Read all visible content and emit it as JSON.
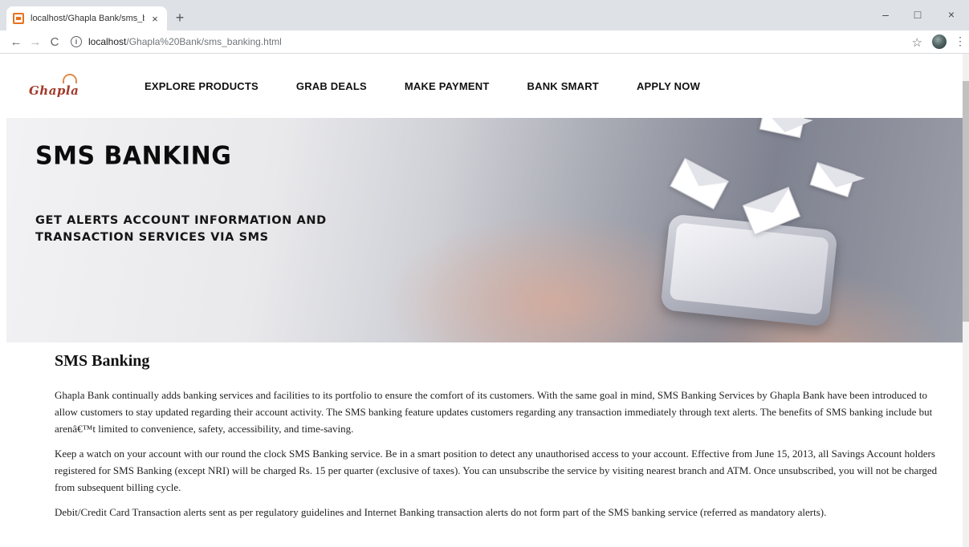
{
  "browser": {
    "tab_title": "localhost/Ghapla Bank/sms_bank",
    "tab_close": "×",
    "new_tab": "+",
    "url_host": "localhost",
    "url_path": "/Ghapla%20Bank/sms_banking.html",
    "window_controls": {
      "minimize": "–",
      "maximize": "□",
      "close": "×"
    },
    "nav": {
      "back": "←",
      "forward": "→",
      "reload": "C"
    },
    "star": "☆",
    "menu": "⋮",
    "favicon_color": "#e8711c"
  },
  "site": {
    "logo_text": "Ghapla",
    "nav_items": [
      "EXPLORE PRODUCTS",
      "GRAB DEALS",
      "MAKE PAYMENT",
      "BANK SMART",
      "APPLY NOW"
    ]
  },
  "hero": {
    "title": "SMS BANKING",
    "subtitle": "GET ALERTS ACCOUNT INFORMATION AND TRANSACTION SERVICES VIA SMS"
  },
  "content": {
    "heading": "SMS Banking",
    "paragraphs": [
      "Ghapla Bank continually adds banking services and facilities to its portfolio to ensure the comfort of its customers. With the same goal in mind, SMS Banking Services by Ghapla Bank have been introduced to allow customers to stay updated regarding their account activity. The SMS banking feature updates customers regarding any transaction immediately through text alerts. The benefits of SMS banking include but arenâ€™t limited to convenience, safety, accessibility, and time-saving.",
      "Keep a watch on your account with our round the clock SMS Banking service. Be in a smart position to detect any unauthorised access to your account. Effective from June 15, 2013, all Savings Account holders registered for SMS Banking (except NRI) will be charged Rs. 15 per quarter (exclusive of taxes). You can unsubscribe the service by visiting nearest branch and ATM. Once unsubscribed, you will not be charged from subsequent billing cycle.",
      "Debit/Credit Card Transaction alerts sent as per regulatory guidelines and Internet Banking transaction alerts do not form part of the SMS banking service (referred as mandatory alerts)."
    ]
  }
}
